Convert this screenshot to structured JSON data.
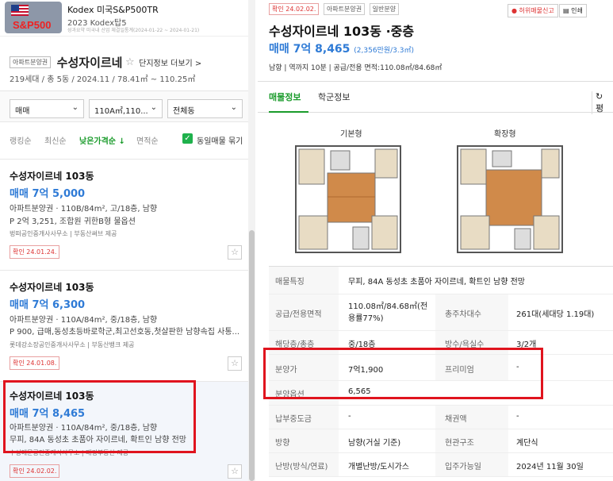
{
  "ad": {
    "title": "Kodex 미국S&P500TR",
    "sub": "2023 Kodex탑5",
    "note": "성과요약 미국내 산업 체결일통계(2024-01-22 ~ 2024-01-21)",
    "logo_text": "S&P500"
  },
  "complex": {
    "tag": "아파트분양권",
    "name": "수성자이르네",
    "star": "☆",
    "link": "단지정보 더보기 >",
    "info": "219세대 / 총 5동 / 2024.11 / 78.41㎡ ~ 110.25㎡"
  },
  "filters": {
    "type": "매매",
    "area": "110A㎡,110...",
    "dong": "전체동"
  },
  "sort": {
    "rank": "랭킹순",
    "latest": "최신순",
    "low_price": "낮은가격순 ↓",
    "area": "면적순",
    "same": "동일매물 묶기"
  },
  "listings": [
    {
      "title": "수성자이르네 103동",
      "price": "매매 7억 5,000",
      "line1": "아파트분양권 · 110B/84m², 고/18층, 남향",
      "line2": "P 2억 3,251, 조합원 귀한B형 물옵션",
      "agent": "벙떠공인중개사사무소 | 부동산써브 제공",
      "confirm": "확인 24.01.24."
    },
    {
      "title": "수성자이르네 103동",
      "price": "매매 7억 6,300",
      "line1": "아파트분양권 · 110A/84m², 중/18층, 남향",
      "line2": "P 900, 급매,동성초등바로학군,최고선호동,첫살판한 남향속집 사통...",
      "agent": "롯데강소장공인중개사사무소 | 부동산뱅크 제공",
      "confirm": "확인 24.01.08."
    },
    {
      "title": "수성자이르네 103동",
      "price": "매매 7억 8,465",
      "line1": "아파트분양권 · 110A/84m², 중/18층, 남향",
      "line2": "무피, 84A 동성초 초품아 자이르네, 확트인 남향 전망",
      "agent": "수성예문공인중개사사무소 | 매경부동산 제공",
      "confirm": "확인 24.02.02."
    }
  ],
  "detail": {
    "badges": [
      "확인 24.02.02.",
      "아파트분양권",
      "일반분양"
    ],
    "report": "허위매물신고",
    "print": "인쇄",
    "title": "수성자이르네 103동 ·중층",
    "price": "매매 7억 8,465",
    "price_sub": "(2,356만원/3.3㎡)",
    "summary": "남향 | 역까지 10분 | 공급/전용 면적:110.08㎡/84.68㎡",
    "tabs": [
      "매물정보",
      "학군정보"
    ],
    "refresh": "↻ 평",
    "plan_labels": [
      "기본형",
      "확장형"
    ],
    "specs": [
      {
        "k": "매물특징",
        "v": "무피, 84A 동성초 초품아 자이르네, 확트인 남향 전망",
        "k2": "",
        "v2": ""
      },
      {
        "k": "공급/전용면적",
        "v": "110.08㎡/84.68㎡(전용률77%)",
        "k2": "총주차대수",
        "v2": "261대(세대당 1.19대)"
      },
      {
        "k": "해당층/총층",
        "v": "중/18층",
        "k2": "방수/욕실수",
        "v2": "3/2개"
      },
      {
        "k": "분양가",
        "v": "7억1,900",
        "k2": "프리미엄",
        "v2": "-"
      },
      {
        "k": "분양옵션",
        "v": "6,565",
        "k2": "",
        "v2": ""
      },
      {
        "k": "납부중도금",
        "v": "-",
        "k2": "채권액",
        "v2": "-"
      },
      {
        "k": "방향",
        "v": "남향(거실 기준)",
        "k2": "현관구조",
        "v2": "계단식"
      },
      {
        "k": "난방(방식/연료)",
        "v": "개별난방/도시가스",
        "k2": "입주가능일",
        "v2": "2024년 11월 30일"
      }
    ]
  },
  "colors": {
    "accent_green": "#1a9b2b",
    "price_blue": "#2f7bd6",
    "highlight_red": "#e0141e"
  }
}
